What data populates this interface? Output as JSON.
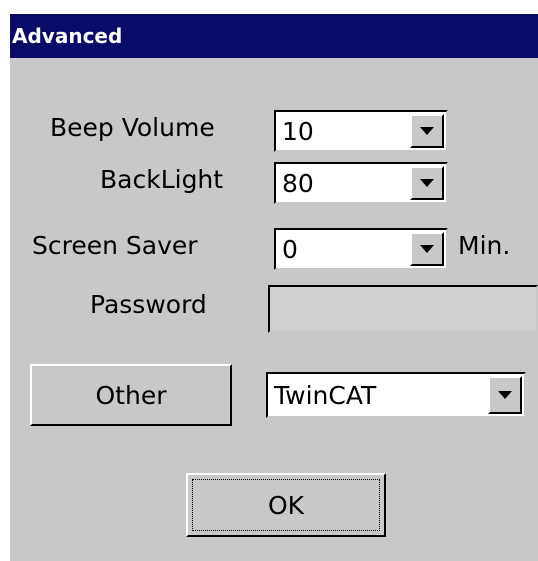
{
  "dialog": {
    "title": "Advanced"
  },
  "fields": {
    "beep_volume": {
      "label": "Beep Volume",
      "value": "10"
    },
    "backlight": {
      "label": "BackLight",
      "value": "80"
    },
    "screen_saver": {
      "label": "Screen Saver",
      "value": "0",
      "unit": "Min."
    },
    "password": {
      "label": "Password",
      "value": ""
    }
  },
  "other": {
    "button_label": "Other",
    "select_value": "TwinCAT"
  },
  "ok_button": {
    "label": "OK"
  },
  "colors": {
    "titlebar": "#0a0a68",
    "face": "#c8c8c8",
    "field_bg": "#ffffff"
  },
  "icons": {
    "dropdown": "chevron-down-icon"
  }
}
